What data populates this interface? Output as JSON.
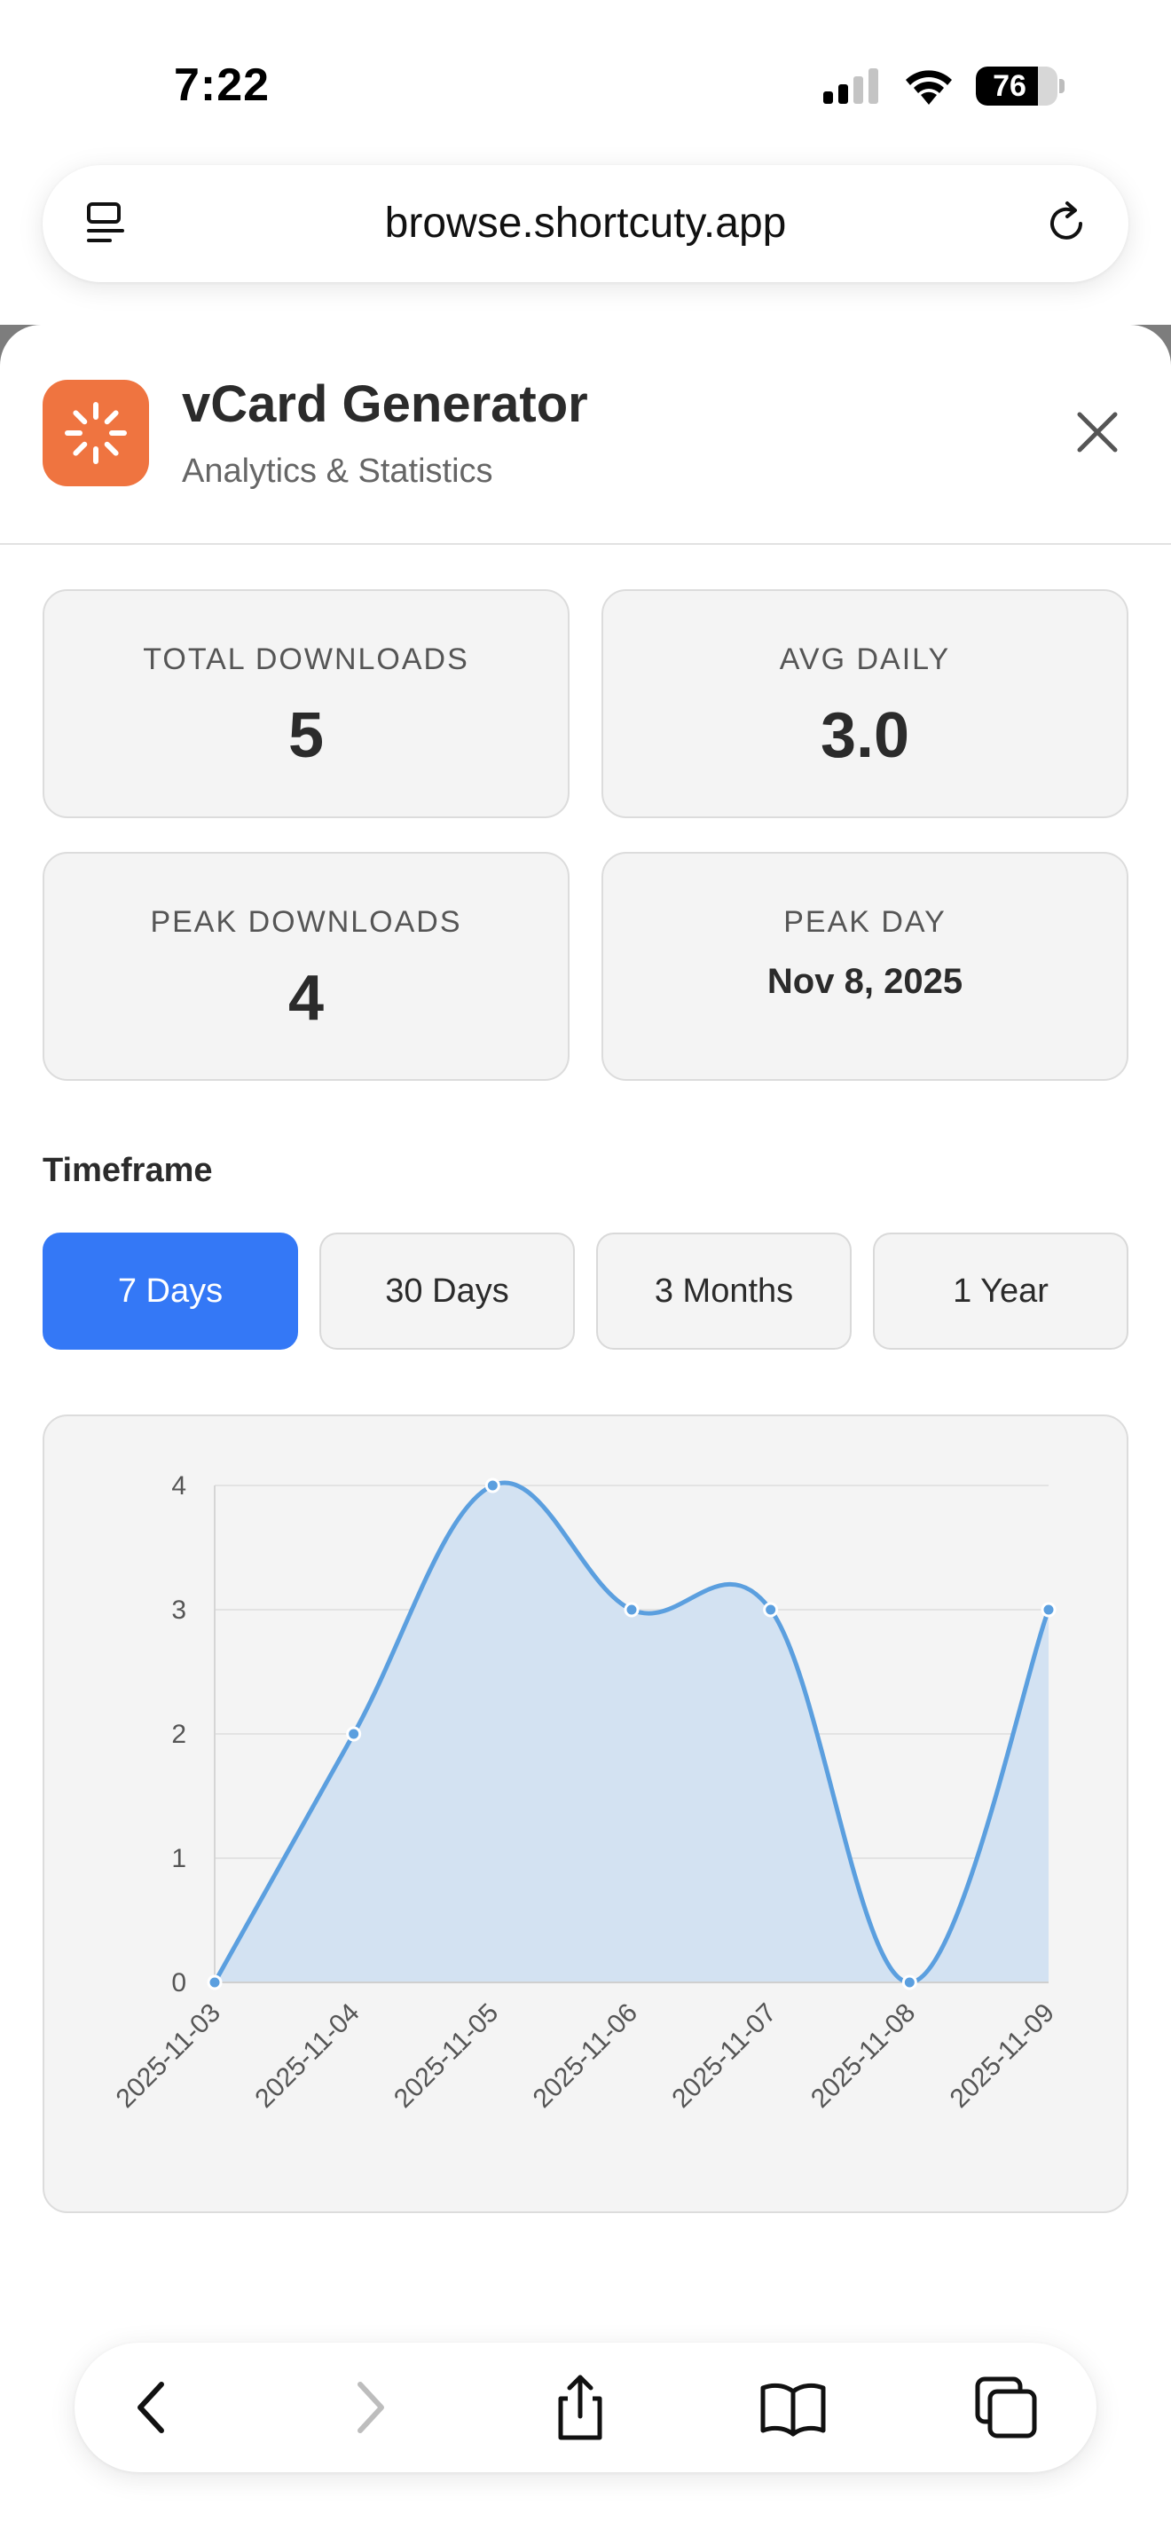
{
  "status_bar": {
    "time": "7:22",
    "battery_level": "76"
  },
  "url_bar": {
    "url": "browse.shortcuty.app"
  },
  "app": {
    "title": "vCard Generator",
    "subtitle": "Analytics & Statistics",
    "icon_color": "#ef7440"
  },
  "stats": {
    "total_downloads": {
      "label": "TOTAL DOWNLOADS",
      "value": "5"
    },
    "avg_daily": {
      "label": "AVG DAILY",
      "value": "3.0"
    },
    "peak_downloads": {
      "label": "PEAK DOWNLOADS",
      "value": "4"
    },
    "peak_day": {
      "label": "PEAK DAY",
      "value": "Nov 8, 2025"
    }
  },
  "timeframe": {
    "label": "Timeframe",
    "options": [
      "7 Days",
      "30 Days",
      "3 Months",
      "1 Year"
    ],
    "selected": "7 Days",
    "accent_color": "#3478f6"
  },
  "chart_data": {
    "type": "area",
    "categories": [
      "2025-11-03",
      "2025-11-04",
      "2025-11-05",
      "2025-11-06",
      "2025-11-07",
      "2025-11-08",
      "2025-11-09"
    ],
    "series": [
      {
        "values": [
          0,
          2,
          4,
          3,
          3,
          0,
          3
        ]
      }
    ],
    "yticks": [
      "0",
      "1",
      "2",
      "3",
      "4"
    ],
    "ylim": [
      0,
      4
    ],
    "grid": true,
    "line_color": "#5b9fdf",
    "fill_color": "#d3e2f2"
  },
  "toolbar": {
    "icons": [
      "back-icon",
      "forward-icon",
      "share-icon",
      "bookmarks-icon",
      "tabs-icon"
    ]
  }
}
